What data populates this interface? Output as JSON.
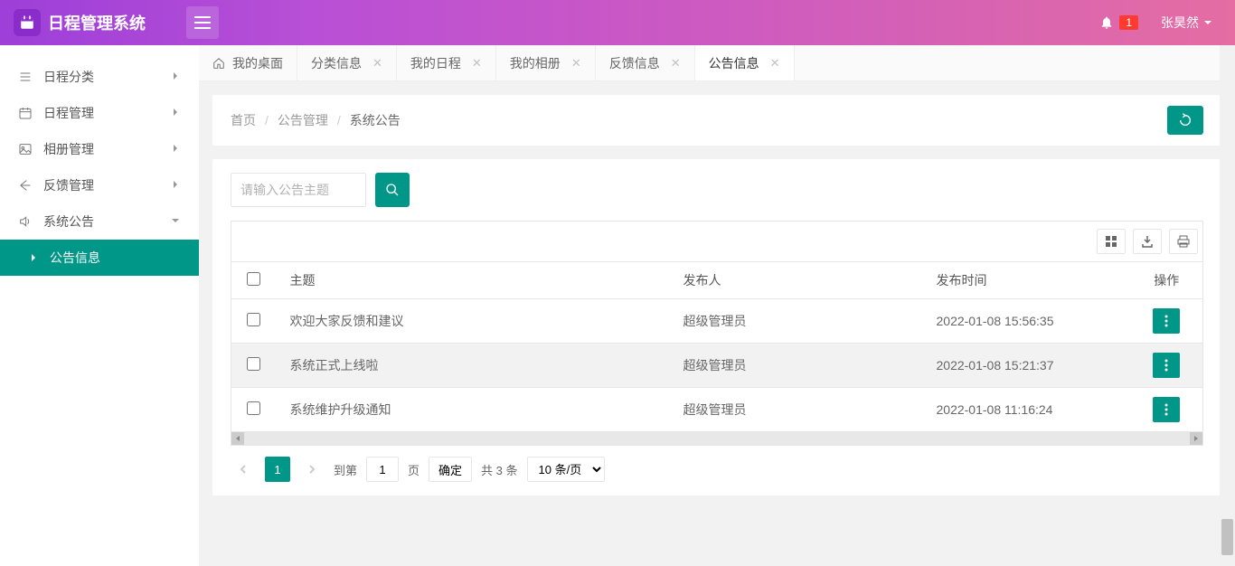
{
  "app": {
    "title": "日程管理系统"
  },
  "header": {
    "notification_count": "1",
    "username": "张昊然"
  },
  "sidebar": {
    "items": [
      {
        "label": "日程分类",
        "expanded": false
      },
      {
        "label": "日程管理",
        "expanded": false
      },
      {
        "label": "相册管理",
        "expanded": false
      },
      {
        "label": "反馈管理",
        "expanded": false
      },
      {
        "label": "系统公告",
        "expanded": true
      }
    ],
    "sub_item": "公告信息"
  },
  "tabs": [
    {
      "label": "我的桌面",
      "closable": false,
      "home": true
    },
    {
      "label": "分类信息",
      "closable": true
    },
    {
      "label": "我的日程",
      "closable": true
    },
    {
      "label": "我的相册",
      "closable": true
    },
    {
      "label": "反馈信息",
      "closable": true
    },
    {
      "label": "公告信息",
      "closable": true,
      "active": true
    }
  ],
  "breadcrumb": {
    "root": "首页",
    "mid": "公告管理",
    "current": "系统公告"
  },
  "search": {
    "placeholder": "请输入公告主题"
  },
  "table": {
    "headers": {
      "subject": "主题",
      "publisher": "发布人",
      "time": "发布时间",
      "op": "操作"
    },
    "rows": [
      {
        "subject": "欢迎大家反馈和建议",
        "publisher": "超级管理员",
        "time": "2022-01-08 15:56:35"
      },
      {
        "subject": "系统正式上线啦",
        "publisher": "超级管理员",
        "time": "2022-01-08 15:21:37"
      },
      {
        "subject": "系统维护升级通知",
        "publisher": "超级管理员",
        "time": "2022-01-08 11:16:24"
      }
    ]
  },
  "pagination": {
    "current": "1",
    "goto_label": "到第",
    "goto_value": "1",
    "page_suffix": "页",
    "confirm": "确定",
    "total": "共 3 条",
    "per_page": "10 条/页"
  }
}
